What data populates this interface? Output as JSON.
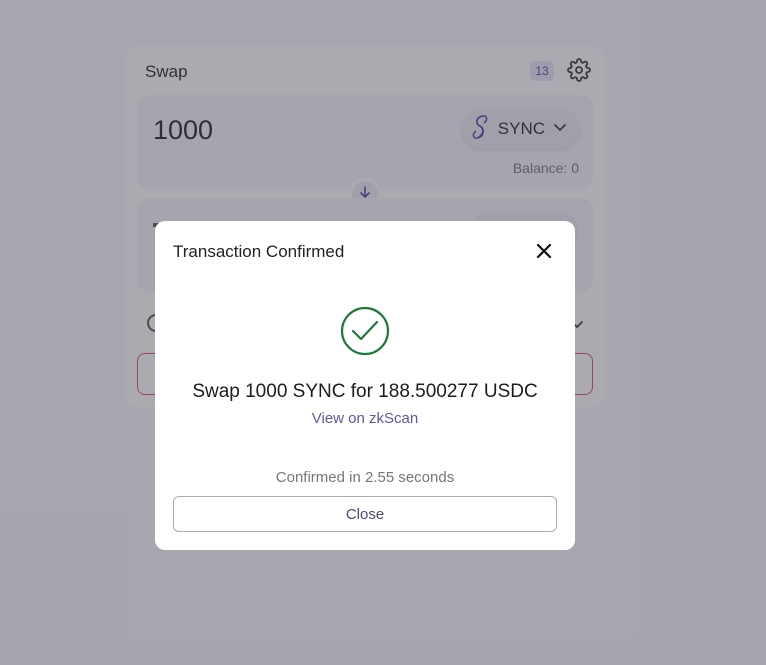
{
  "swap_card": {
    "title": "Swap",
    "count_badge": "13",
    "from": {
      "amount": "1000",
      "token": "SYNC",
      "balance": "Balance: 0"
    }
  },
  "modal": {
    "title": "Transaction Confirmed",
    "message": "Swap 1000 SYNC for 188.500277 USDC",
    "link_label": "View on zkScan",
    "confirmed_text": "Confirmed in 2.55 seconds",
    "close_label": "Close"
  },
  "colors": {
    "success": "#1e7a3c",
    "link": "#5a5aa0",
    "danger_border": "#e04b5a"
  }
}
